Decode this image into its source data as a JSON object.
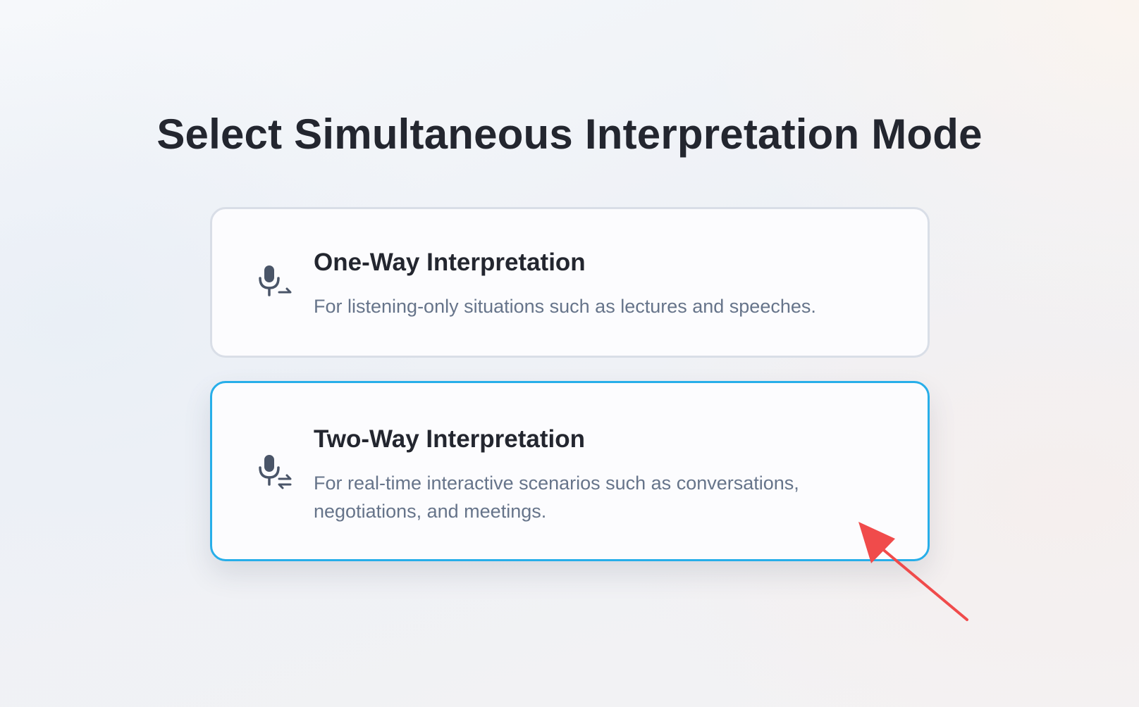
{
  "page": {
    "title": "Select Simultaneous Interpretation Mode"
  },
  "modes": [
    {
      "title": "One-Way Interpretation",
      "description": "For listening-only situations such as lectures and speeches.",
      "icon": "microphone-one-way-icon",
      "selected": false
    },
    {
      "title": "Two-Way Interpretation",
      "description": "For real-time interactive scenarios such as conversations, negotiations, and meetings.",
      "icon": "microphone-two-way-icon",
      "selected": true
    }
  ],
  "colors": {
    "title_text": "#23262f",
    "description_text": "#66748a",
    "icon": "#4a5568",
    "selected_border": "#27aee9",
    "default_border": "#d9dee7",
    "annotation_arrow": "#f04b4b"
  }
}
